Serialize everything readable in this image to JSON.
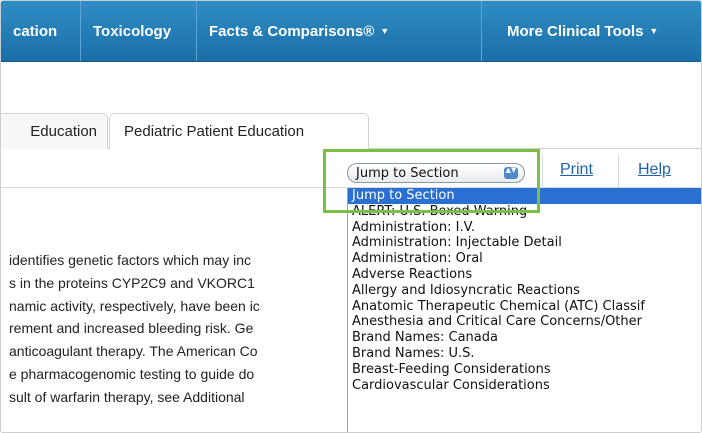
{
  "nav": {
    "items": [
      {
        "label": "cation",
        "caret": ""
      },
      {
        "label": "Toxicology",
        "caret": ""
      },
      {
        "label": "Facts & Comparisons®",
        "caret": "▼"
      },
      {
        "label": "More Clinical Tools",
        "caret": "▼"
      }
    ]
  },
  "tabs": [
    {
      "label": "Education"
    },
    {
      "label": "Pediatric Patient Education"
    }
  ],
  "toolbar": {
    "jump_select_value": "Jump to Section",
    "select_arrows": "▲▼",
    "print_label": "Print",
    "help_label": "Help"
  },
  "dropdown": {
    "options": [
      "Jump to Section",
      "ALERT: U.S. Boxed Warning",
      "Administration: I.V.",
      "Administration: Injectable Detail",
      "Administration: Oral",
      "Adverse Reactions",
      "Allergy and Idiosyncratic Reactions",
      "Anatomic Therapeutic Chemical (ATC) Classif",
      "Anesthesia and Critical Care Concerns/Other",
      "Brand Names: Canada",
      "Brand Names: U.S.",
      "Breast-Feeding Considerations",
      "Cardiovascular Considerations"
    ]
  },
  "body": {
    "lines": [
      "identifies genetic factors which may inc",
      "s in the proteins CYP2C9 and VKORC1",
      "namic activity, respectively, have been ic",
      "rement and increased bleeding risk. Ge",
      "anticoagulant therapy. The American Co",
      "e pharmacogenomic testing to guide do",
      "sult of warfarin therapy, see Additional"
    ]
  },
  "colors": {
    "nav_bar": "#1b6ea7",
    "link": "#1b63b3",
    "selection": "#2a6fd2",
    "highlight_box": "#7ac143"
  }
}
